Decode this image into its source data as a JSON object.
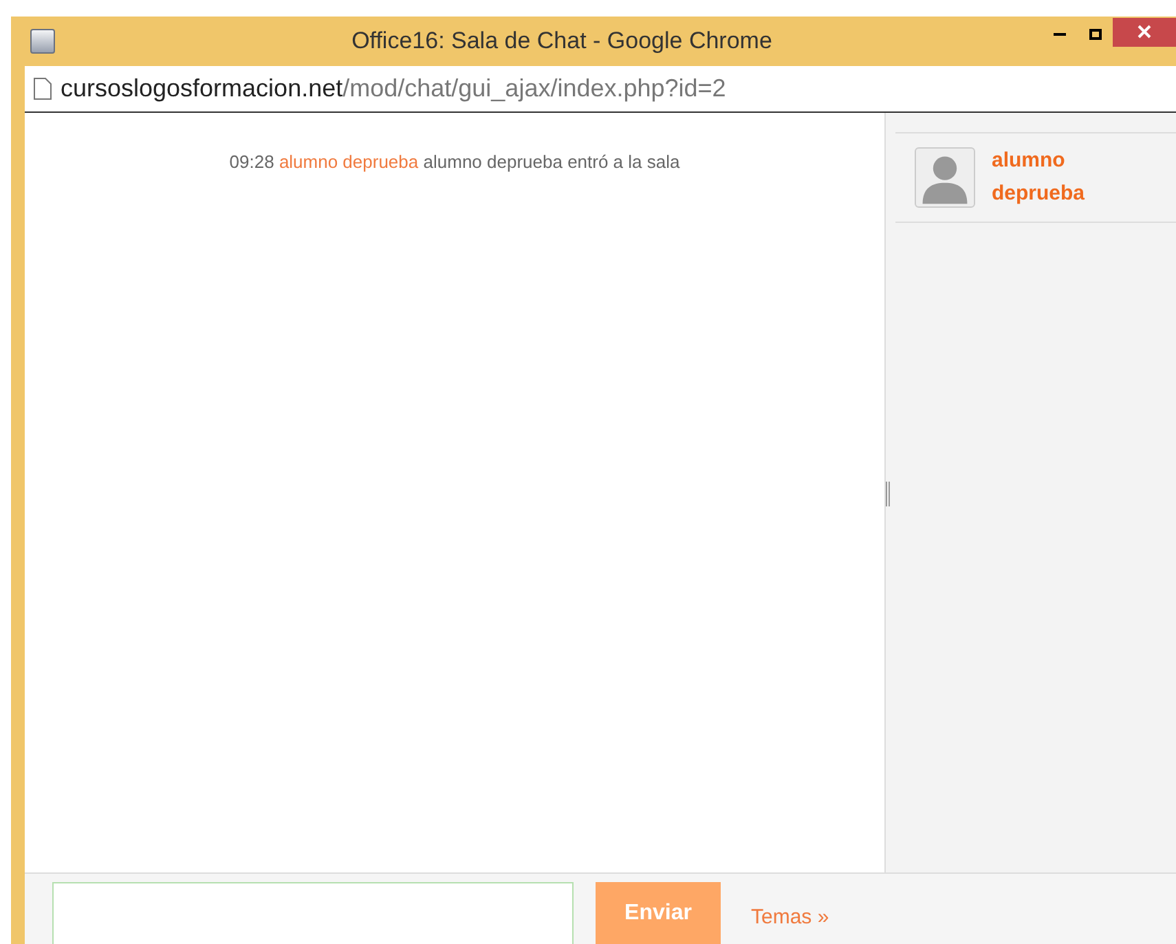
{
  "window": {
    "title": "Office16: Sala de Chat - Google Chrome"
  },
  "address_bar": {
    "domain": "cursoslogosformacion.net",
    "path": "/mod/chat/gui_ajax/index.php?id=2"
  },
  "messages": [
    {
      "time": "09:28",
      "user": "alumno deprueba",
      "text": "alumno deprueba entró a la sala"
    }
  ],
  "users": [
    {
      "name_line_1": "alumno",
      "name_line_2": "deprueba"
    }
  ],
  "composer": {
    "send_button": "Enviar",
    "themes_link": "Temas »"
  }
}
